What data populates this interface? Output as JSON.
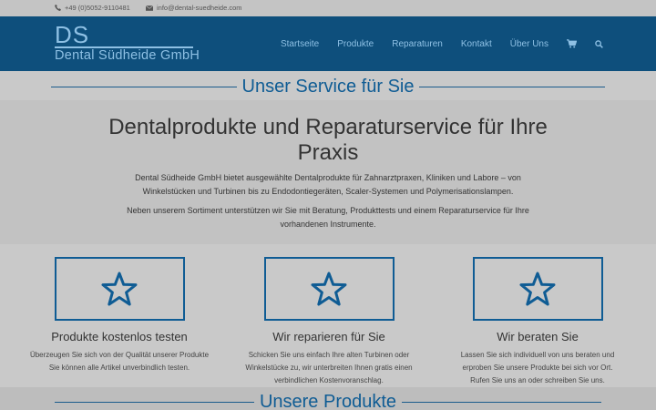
{
  "topbar": {
    "phone": "+49 (0)5052-9110481",
    "email": "info@dental-suedheide.com"
  },
  "logo": {
    "initials": "DS",
    "name": "Dental Südheide GmbH"
  },
  "nav": {
    "items": [
      {
        "label": "Startseite"
      },
      {
        "label": "Produkte"
      },
      {
        "label": "Reparaturen"
      },
      {
        "label": "Kontakt"
      },
      {
        "label": "Über Uns"
      }
    ],
    "icons": [
      "cart-icon",
      "search-icon"
    ]
  },
  "service_section": {
    "title": "Unser Service für Sie"
  },
  "intro": {
    "heading": "Dentalprodukte und Reparaturservice für Ihre Praxis",
    "paragraph1": "Dental Südheide GmbH bietet ausgewählte Dentalprodukte für Zahnarztpraxen, Kliniken und Labore – von Winkelstücken und Turbinen bis zu Endodontiegeräten, Scaler-Systemen und Polymerisationslampen.",
    "paragraph2": "Neben unserem Sortiment unterstützen wir Sie mit Beratung, Produkttests und einem Reparaturservice für Ihre vorhandenen Instrumente."
  },
  "features": [
    {
      "title": "Produkte kostenlos testen",
      "line1": "Überzeugen Sie sich von der Qualität unserer Produkte",
      "line2": "Sie können alle Artikel unverbindlich testen.",
      "icon": "star-icon"
    },
    {
      "title": "Wir reparieren für Sie",
      "line1": "Schicken Sie uns einfach Ihre alten Turbinen oder Winkelstücke zu, wir unterbreiten Ihnen gratis einen verbindlichen Kostenvoranschlag.",
      "line2": "",
      "icon": "star-icon"
    },
    {
      "title": "Wir beraten Sie",
      "line1": "Lassen Sie sich individuell von uns beraten und erproben Sie unsere Produkte bei sich vor Ort.",
      "line2": "Rufen Sie uns an oder schreiben Sie uns.",
      "icon": "star-icon"
    }
  ],
  "products_section": {
    "title": "Unsere Produkte"
  },
  "colors": {
    "header_bg": "#0e4f7c",
    "accent": "#0f5c94",
    "overlay_gray": "#c9c9c9"
  }
}
